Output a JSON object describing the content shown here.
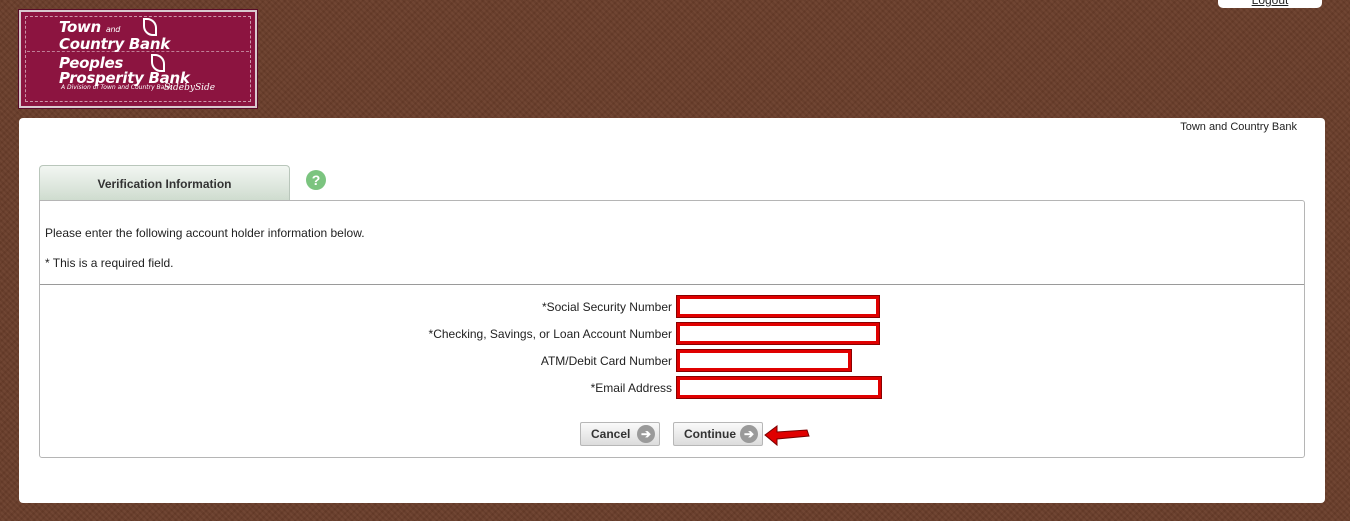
{
  "header": {
    "logo": {
      "line1": "Town",
      "line1_small": "and",
      "line1b": "Country",
      "line1c": "Bank",
      "line2": "Peoples",
      "line2b": "Prosperity",
      "line2c": "Bank",
      "tagline": "A Division of Town and Country Bank",
      "sidebyside": "SidebySide"
    },
    "logout": "Logout"
  },
  "panel": {
    "bank_name": "Town and Country Bank",
    "tab_label": "Verification Information",
    "help_icon": "question-icon",
    "intro": "Please enter the following account holder information below.",
    "required_note": "* This is a required field.",
    "fields": [
      {
        "label": "*Social Security Number",
        "value": ""
      },
      {
        "label": "*Checking, Savings, or Loan Account Number",
        "value": ""
      },
      {
        "label": "ATM/Debit Card Number",
        "value": ""
      },
      {
        "label": "*Email Address",
        "value": ""
      }
    ],
    "buttons": {
      "cancel": "Cancel",
      "continue": "Continue"
    }
  },
  "colors": {
    "background": "#6b3e2b",
    "logo": "#8c1440",
    "highlight": "#e00000",
    "tab": "#cfdccf",
    "help": "#7bc47f"
  }
}
